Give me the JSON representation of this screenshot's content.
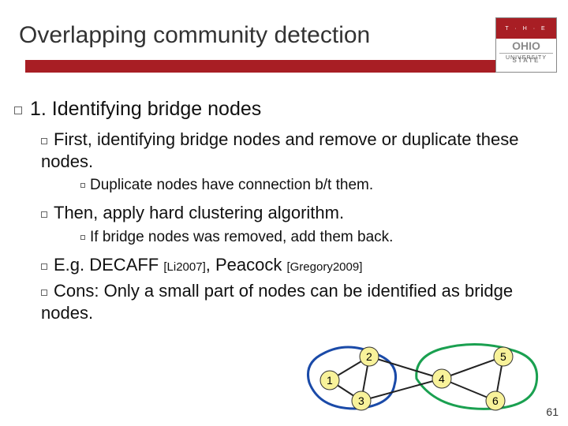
{
  "title": "Overlapping community detection",
  "logo": {
    "top": "T · H · E",
    "mid": "OHIO",
    "sub": "STATE",
    "bot": "UNIVERSITY"
  },
  "heading": "1. Identifying bridge nodes",
  "bullets": {
    "first": "First, identifying bridge nodes and remove or duplicate these nodes.",
    "dup": "Duplicate nodes have connection b/t them.",
    "then": "Then, apply hard clustering algorithm.",
    "addback": "If bridge nodes was removed, add them back.",
    "eg_pre": "E.g. DECAFF ",
    "eg_cite1": "[Li2007]",
    "eg_mid": ", Peacock ",
    "eg_cite2": "[Gregory2009]",
    "cons": "Cons: Only a small part of nodes can be identified as bridge nodes."
  },
  "nodes": {
    "n1": "1",
    "n2": "2",
    "n3": "3",
    "n4": "4",
    "n5": "5",
    "n6": "6"
  },
  "pagenum": "61"
}
